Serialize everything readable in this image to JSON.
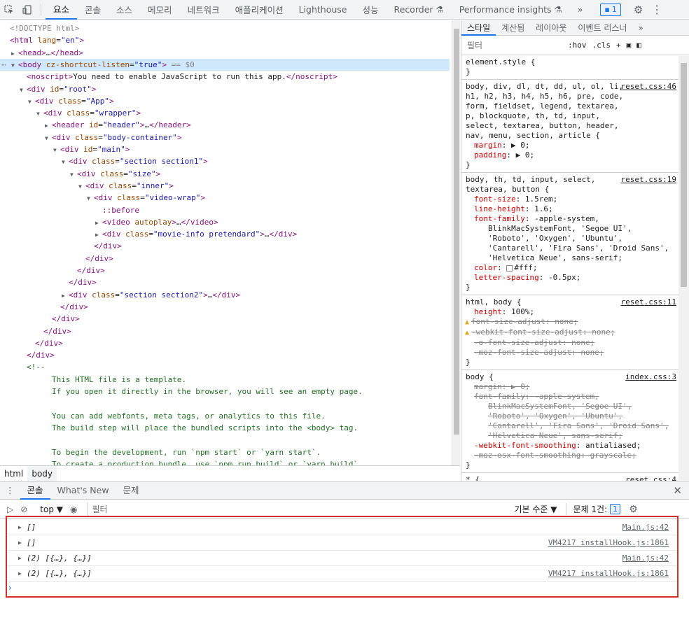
{
  "topbar": {
    "tabs": [
      "요소",
      "콘솔",
      "소스",
      "메모리",
      "네트워크",
      "애플리케이션",
      "Lighthouse",
      "성능",
      "Recorder ⚗",
      "Performance insights ⚗"
    ],
    "more": "»",
    "issues": "1"
  },
  "elements": {
    "lines": [
      {
        "indent": 0,
        "arrow": "",
        "html": "<span class='gray'>&lt;!DOCTYPE html&gt;</span>"
      },
      {
        "indent": 0,
        "arrow": "",
        "html": "<span class='tag'>&lt;html</span> <span class='attr'>lang</span>=<span class='val'>\"en\"</span><span class='tag'>&gt;</span>"
      },
      {
        "indent": 1,
        "arrow": "▶",
        "html": "<span class='tag'>&lt;head&gt;</span>…<span class='tag'>&lt;/head&gt;</span>"
      },
      {
        "indent": 1,
        "arrow": "▼",
        "html": "<span class='tag'>&lt;body</span> <span class='attr'>cz-shortcut-listen</span>=<span class='val'>\"true\"</span><span class='tag'>&gt;</span> <span class='gray'>== $0</span>",
        "selected": true
      },
      {
        "indent": 2,
        "arrow": "",
        "html": "<span class='tag'>&lt;noscript&gt;</span><span class='txt'>You need to enable JavaScript to run this app.</span><span class='tag'>&lt;/noscript&gt;</span>"
      },
      {
        "indent": 2,
        "arrow": "▼",
        "html": "<span class='tag'>&lt;div</span> <span class='attr'>id</span>=<span class='val'>\"root\"</span><span class='tag'>&gt;</span>"
      },
      {
        "indent": 3,
        "arrow": "▼",
        "html": "<span class='tag'>&lt;div</span> <span class='attr'>class</span>=<span class='val'>\"App\"</span><span class='tag'>&gt;</span>"
      },
      {
        "indent": 4,
        "arrow": "▼",
        "html": "<span class='tag'>&lt;div</span> <span class='attr'>class</span>=<span class='val'>\"wrapper\"</span><span class='tag'>&gt;</span>"
      },
      {
        "indent": 5,
        "arrow": "▶",
        "html": "<span class='tag'>&lt;header</span> <span class='attr'>id</span>=<span class='val'>\"header\"</span><span class='tag'>&gt;</span>…<span class='tag'>&lt;/header&gt;</span>"
      },
      {
        "indent": 5,
        "arrow": "▼",
        "html": "<span class='tag'>&lt;div</span> <span class='attr'>class</span>=<span class='val'>\"body-container\"</span><span class='tag'>&gt;</span>"
      },
      {
        "indent": 6,
        "arrow": "▼",
        "html": "<span class='tag'>&lt;div</span> <span class='attr'>id</span>=<span class='val'>\"main\"</span><span class='tag'>&gt;</span>"
      },
      {
        "indent": 7,
        "arrow": "▼",
        "html": "<span class='tag'>&lt;div</span> <span class='attr'>class</span>=<span class='val'>\"section section1\"</span><span class='tag'>&gt;</span>"
      },
      {
        "indent": 8,
        "arrow": "▼",
        "html": "<span class='tag'>&lt;div</span> <span class='attr'>class</span>=<span class='val'>\"size\"</span><span class='tag'>&gt;</span>"
      },
      {
        "indent": 9,
        "arrow": "▼",
        "html": "<span class='tag'>&lt;div</span> <span class='attr'>class</span>=<span class='val'>\"inner\"</span><span class='tag'>&gt;</span>"
      },
      {
        "indent": 10,
        "arrow": "▼",
        "html": "<span class='tag'>&lt;div</span> <span class='attr'>class</span>=<span class='val'>\"video-wrap\"</span><span class='tag'>&gt;</span>"
      },
      {
        "indent": 11,
        "arrow": "",
        "html": "<span class='tag'>::before</span>"
      },
      {
        "indent": 11,
        "arrow": "▶",
        "html": "<span class='tag'>&lt;video</span> <span class='attr'>autoplay</span><span class='tag'>&gt;</span>…<span class='tag'>&lt;/video&gt;</span>"
      },
      {
        "indent": 11,
        "arrow": "▶",
        "html": "<span class='tag'>&lt;div</span> <span class='attr'>class</span>=<span class='val'>\"movie-info pretendard\"</span><span class='tag'>&gt;</span>…<span class='tag'>&lt;/div&gt;</span>"
      },
      {
        "indent": 10,
        "arrow": "",
        "html": "<span class='tag'>&lt;/div&gt;</span>"
      },
      {
        "indent": 9,
        "arrow": "",
        "html": "<span class='tag'>&lt;/div&gt;</span>"
      },
      {
        "indent": 8,
        "arrow": "",
        "html": "<span class='tag'>&lt;/div&gt;</span>"
      },
      {
        "indent": 7,
        "arrow": "",
        "html": "<span class='tag'>&lt;/div&gt;</span>"
      },
      {
        "indent": 7,
        "arrow": "▶",
        "html": "<span class='tag'>&lt;div</span> <span class='attr'>class</span>=<span class='val'>\"section section2\"</span><span class='tag'>&gt;</span>…<span class='tag'>&lt;/div&gt;</span>"
      },
      {
        "indent": 6,
        "arrow": "",
        "html": "<span class='tag'>&lt;/div&gt;</span>"
      },
      {
        "indent": 5,
        "arrow": "",
        "html": "<span class='tag'>&lt;/div&gt;</span>"
      },
      {
        "indent": 4,
        "arrow": "",
        "html": "<span class='tag'>&lt;/div&gt;</span>"
      },
      {
        "indent": 3,
        "arrow": "",
        "html": "<span class='tag'>&lt;/div&gt;</span>"
      },
      {
        "indent": 2,
        "arrow": "",
        "html": "<span class='tag'>&lt;/div&gt;</span>"
      },
      {
        "indent": 2,
        "arrow": "",
        "html": "<span class='cmt'>&lt;!--</span>"
      },
      {
        "indent": 5,
        "arrow": "",
        "html": "<span class='cmt'>This HTML file is a template.</span>"
      },
      {
        "indent": 5,
        "arrow": "",
        "html": "<span class='cmt'>If you open it directly in the browser, you will see an empty page.</span>"
      },
      {
        "indent": 5,
        "arrow": "",
        "html": ""
      },
      {
        "indent": 5,
        "arrow": "",
        "html": "<span class='cmt'>You can add webfonts, meta tags, or analytics to this file.</span>"
      },
      {
        "indent": 5,
        "arrow": "",
        "html": "<span class='cmt'>The build step will place the bundled scripts into the &lt;body&gt; tag.</span>"
      },
      {
        "indent": 5,
        "arrow": "",
        "html": ""
      },
      {
        "indent": 5,
        "arrow": "",
        "html": "<span class='cmt'>To begin the development, run `npm start` or `yarn start`.</span>"
      },
      {
        "indent": 5,
        "arrow": "",
        "html": "<span class='cmt'>To create a production bundle, use `npm run build` or `yarn build`.</span>"
      }
    ]
  },
  "breadcrumbs": [
    "html",
    "body"
  ],
  "styles": {
    "tabs": [
      "스타일",
      "계산됨",
      "레이아웃",
      "이벤트 리스너"
    ],
    "more": "»",
    "filter_placeholder": "필터",
    "hov": ":hov",
    "cls": ".cls",
    "plus": "+",
    "element_style": "element.style {",
    "close_brace": "}",
    "rule1": {
      "src": "reset.css:46",
      "selector": "body, div, dl, dt, dd, ul, ol, li, h1, h2, h3, h4, h5, h6, pre, code, form, fieldset, legend, textarea, p, blockquote, th, td, input, select, textarea, button, header, nav, menu, section, article {",
      "margin": "margin",
      "margin_val": "▶ 0;",
      "padding": "padding",
      "padding_val": "▶ 0;"
    },
    "rule2": {
      "src": "reset.css:19",
      "selector": "body, th, td, input, select, textarea, button {",
      "p1n": "font-size",
      "p1v": ": 1.5rem;",
      "p2n": "line-height",
      "p2v": ": 1.6;",
      "p3n": "font-family",
      "p3v": ": -apple-system,",
      "c1": "BlinkMacSystemFont, 'Segoe UI',",
      "c2": "'Roboto', 'Oxygen', 'Ubuntu',",
      "c3": "'Cantarell', 'Fira Sans', 'Droid Sans',",
      "c4": "'Helvetica Neue', sans-serif;",
      "p4n": "color",
      "p4v": "#fff;",
      "p5n": "letter-spacing",
      "p5v": ": -0.5px;"
    },
    "rule3": {
      "src": "reset.css:11",
      "selector": "html, body {",
      "p1n": "height",
      "p1v": ": 100%;",
      "p2": "font-size-adjust: none;",
      "p3": "-webkit-font-size-adjust: none;",
      "p4": "-o-font-size-adjust: none;",
      "p5": "-moz-font-size-adjust: none;"
    },
    "rule4": {
      "src": "index.css:3",
      "selector": "body {",
      "p1": "margin: ▶ 0;",
      "p2": "font-family: -apple-system,",
      "c1": "BlinkMacSystemFont, 'Segoe UI',",
      "c2": "'Roboto', 'Oxygen', 'Ubuntu',",
      "c3": "'Cantarell', 'Fira Sans', 'Droid Sans',",
      "c4": "'Helvetica Neue', sans-serif;",
      "p3n": "-webkit-font-smoothing",
      "p3v": ": antialiased;",
      "p4": "-moz-osx-font-smoothing: grayscale;"
    },
    "rule5": {
      "src": "reset.css:4",
      "selector": "* {"
    }
  },
  "drawer": {
    "tabs": [
      "콘솔",
      "What's New",
      "문제"
    ],
    "close": "✕"
  },
  "console": {
    "context": "top ▼",
    "filter_placeholder": "필터",
    "levels": "기본 수준 ▼",
    "issues_label": "문제 1건:",
    "issues_count": "1",
    "messages": [
      {
        "text": "[]",
        "src": "Main.js:42"
      },
      {
        "text": "[]",
        "src": "VM4217 installHook.js:1861"
      },
      {
        "text": "(2) [{…}, {…}]",
        "src": "Main.js:42"
      },
      {
        "text": "(2) [{…}, {…}]",
        "src": "VM4217 installHook.js:1861"
      }
    ],
    "prompt": "›"
  }
}
